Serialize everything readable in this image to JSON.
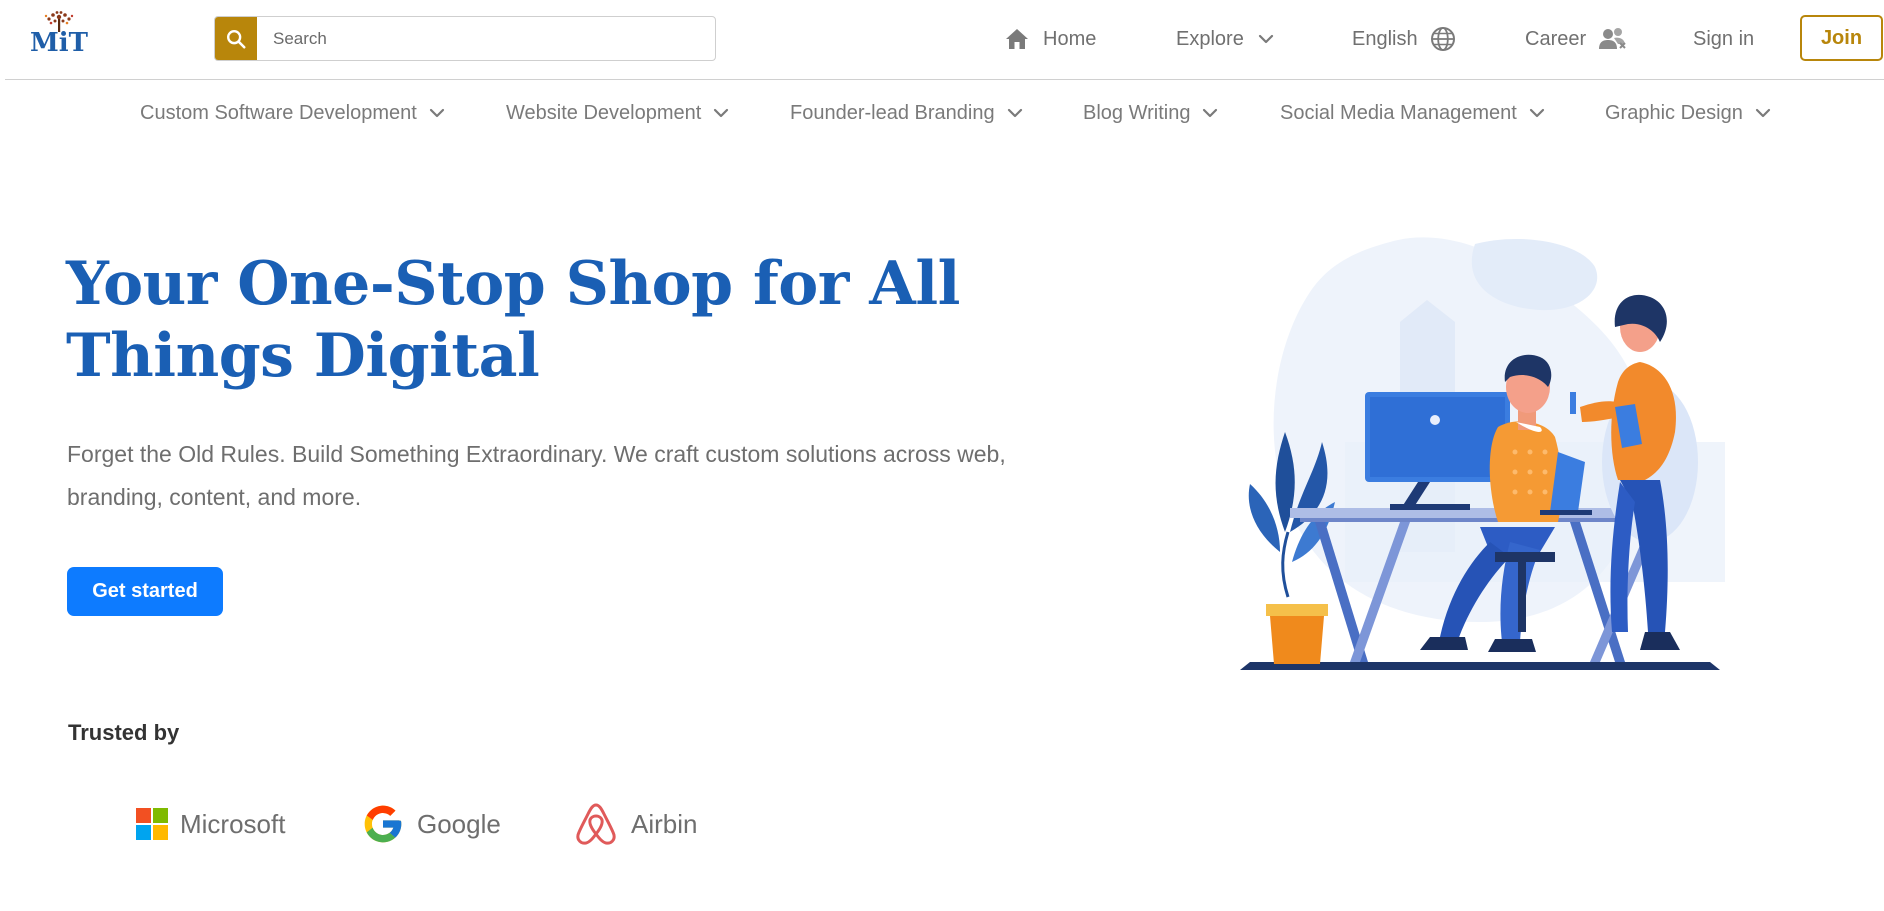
{
  "header": {
    "logo_text": "MiT",
    "search": {
      "placeholder": "Search",
      "value": ""
    },
    "nav": {
      "home": "Home",
      "explore": "Explore",
      "language": "English",
      "career": "Career",
      "sign_in": "Sign in",
      "join": "Join"
    }
  },
  "categories": [
    {
      "label": "Custom Software Development"
    },
    {
      "label": "Website Development"
    },
    {
      "label": "Founder-lead Branding"
    },
    {
      "label": "Blog Writing"
    },
    {
      "label": "Social Media Management"
    },
    {
      "label": "Graphic Design"
    }
  ],
  "hero": {
    "title": "Your One-Stop Shop for All Things Digital",
    "subtitle": "Forget the Old Rules. Build Something Extraordinary. We craft custom solutions across web, branding, content, and more.",
    "cta": "Get started"
  },
  "trusted": {
    "label": "Trusted by",
    "partners": [
      {
        "name": "Microsoft",
        "icon": "microsoft-logo-icon"
      },
      {
        "name": "Google",
        "icon": "google-logo-icon"
      },
      {
        "name": "Airbin",
        "icon": "airbnb-logo-icon"
      }
    ]
  },
  "colors": {
    "accent_gold": "#b8860b",
    "title_blue": "#1a5fb4",
    "cta_blue": "#0d7bff",
    "logo_blue": "#1f5ea8"
  }
}
